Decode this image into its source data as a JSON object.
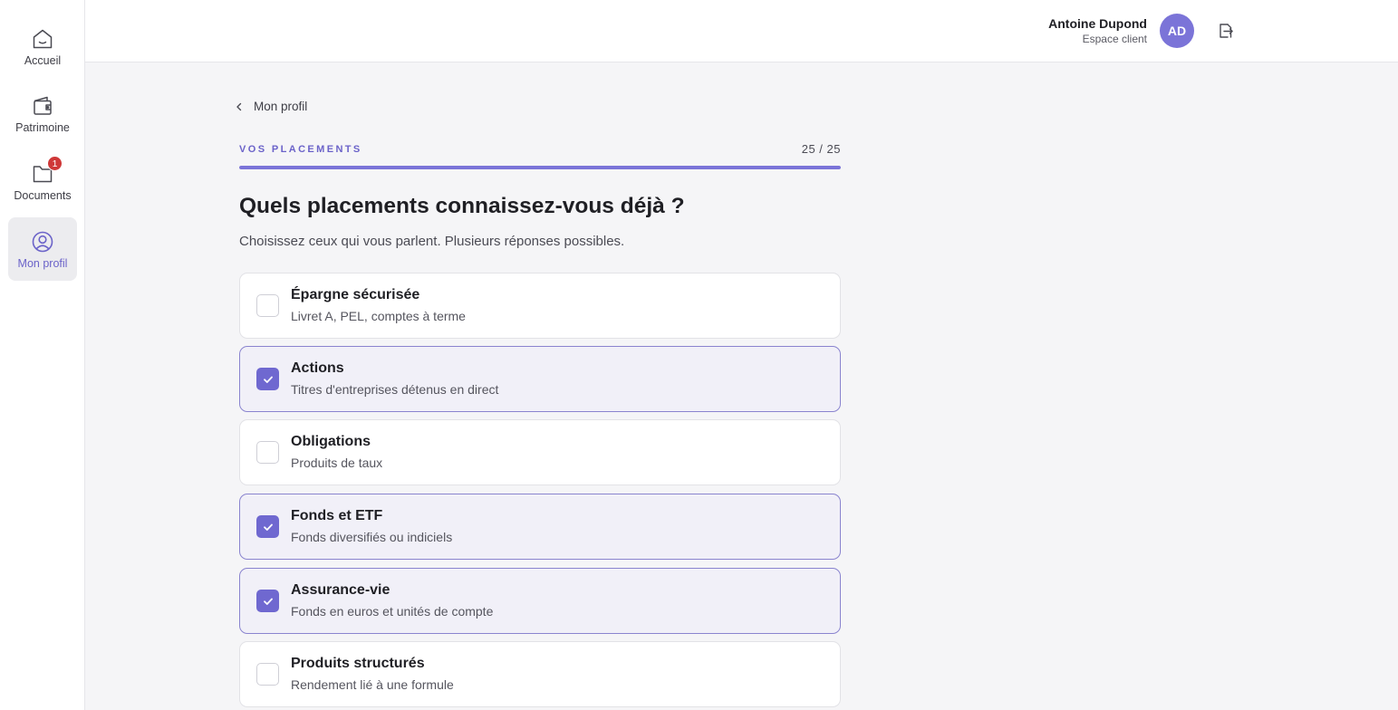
{
  "sidebar": {
    "items": [
      {
        "id": "home",
        "label": "Accueil",
        "icon": "home-icon",
        "active": false
      },
      {
        "id": "patrimoine",
        "label": "Patrimoine",
        "icon": "wallet-icon",
        "active": false
      },
      {
        "id": "documents",
        "label": "Documents",
        "icon": "folder-icon",
        "active": false,
        "badge": "1"
      },
      {
        "id": "profile",
        "label": "Mon profil",
        "icon": "user-circle-icon",
        "active": true
      }
    ]
  },
  "header": {
    "user_name": "Antoine Dupond",
    "user_role": "Espace client",
    "avatar_initials": "AD",
    "logout_icon": "logout-icon"
  },
  "breadcrumb": {
    "back_label": "Mon profil"
  },
  "step": {
    "section": "VOS PLACEMENTS",
    "counter": "25 / 25",
    "progress": 1.0
  },
  "question": {
    "title": "Quels placements connaissez-vous déjà ?",
    "hint": "Choisissez ceux qui vous parlent. Plusieurs réponses possibles."
  },
  "options": [
    {
      "title": "Épargne sécurisée",
      "subtitle": "Livret A, PEL, comptes à terme",
      "checked": false
    },
    {
      "title": "Actions",
      "subtitle": "Titres d'entreprises détenus en direct",
      "checked": true
    },
    {
      "title": "Obligations",
      "subtitle": "Produits de taux",
      "checked": false
    },
    {
      "title": "Fonds et ETF",
      "subtitle": "Fonds diversifiés ou indiciels",
      "checked": true
    },
    {
      "title": "Assurance-vie",
      "subtitle": "Fonds en euros et unités de compte",
      "checked": true
    },
    {
      "title": "Produits structurés",
      "subtitle": "Rendement lié à une formule",
      "checked": false
    }
  ],
  "colors": {
    "accent": "#7b74d8",
    "badge": "#cf3838"
  }
}
